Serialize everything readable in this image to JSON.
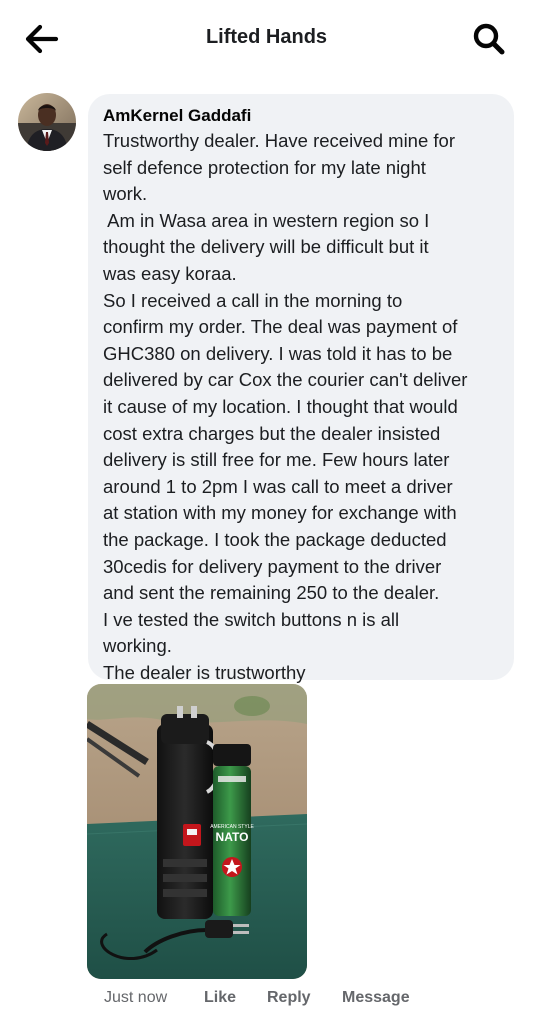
{
  "header": {
    "title": "Lifted Hands",
    "back_icon": "arrow-left-icon",
    "search_icon": "search-icon"
  },
  "comment": {
    "author": "AmKernel Gaddafi",
    "lines": [
      "Trustworthy dealer. Have received mine for",
      "self defence protection for my late night",
      "work.",
      " Am in Wasa area in western region so I",
      "thought the delivery will be difficult but it",
      "was easy koraa.",
      "So I received a call in the morning to",
      "confirm my order. The deal was payment of",
      "GHC380 on delivery. I was told it has to be",
      "delivered by car Cox the courier can't deliver",
      "it cause of my location. I thought that would",
      "cost extra charges but the dealer insisted",
      "delivery is still free for me. Few hours later",
      "around 1 to 2pm I was call to meet a driver",
      "at station with my money for exchange with",
      "the package. I took the package deducted",
      "30cedis for delivery payment to the driver",
      "and sent the remaining 250 to the dealer.",
      "I ve tested the switch buttons n is all",
      "working.",
      "The dealer is trustworthy"
    ],
    "photo": {
      "spray_label": "NATO",
      "spray_sublabel": "AMERICAN STYLE"
    }
  },
  "actions": {
    "time": "Just now",
    "like": "Like",
    "reply": "Reply",
    "message": "Message"
  },
  "colors": {
    "bubble_bg": "#f0f2f5",
    "meta_text": "#65676b",
    "text": "#050505"
  }
}
